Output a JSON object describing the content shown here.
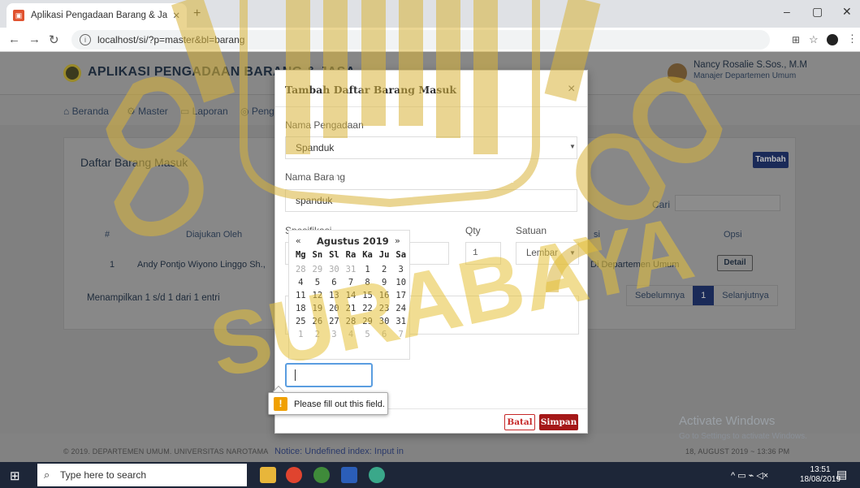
{
  "browser": {
    "tab_title": "Aplikasi Pengadaan Barang & Ja",
    "new_tab": "+",
    "url": "localhost/si/?p=master&bl=barang",
    "window_controls": [
      "–",
      "▢",
      "✕"
    ]
  },
  "app": {
    "title": "APLIKASI PENGADAAN BARANG & JASA",
    "user_name": "Nancy Rosalie S.Sos., M.M",
    "user_role": "Manajer Departemen Umum",
    "menu": [
      "Beranda",
      "Master",
      "Laporan",
      "Peng"
    ],
    "card_title": "Daftar Barang Masuk",
    "add_button": "Tambah",
    "search_label": "Cari",
    "table": {
      "headers": [
        "#",
        "Diajukan Oleh",
        "si",
        "Opsi"
      ],
      "rows": [
        {
          "no": "1",
          "by": "Andy Pontjo Wiyono Linggo Sh.,",
          "dept": "Di Departemen Umum",
          "action": "Detail"
        }
      ]
    },
    "info": "Menampilkan 1 s/d 1 dari 1 entri",
    "pager": [
      "Sebelumnya",
      "1",
      "Selanjutnya"
    ],
    "footer_copy": "© 2019. DEPARTEMEN UMUM. UNIVERSITAS NAROTAMA",
    "notice": "Notice: Undefined index: Input in",
    "footer_date": "18, AUGUST 2019 ~ 13:36 PM"
  },
  "modal": {
    "title": "Tambah Daftar Barang Masuk",
    "close": "×",
    "label_pengadaan": "Nama Pengadaan",
    "pengadaan_value": "Spanduk",
    "label_barang": "Nama Barang",
    "barang_value": "spanduk",
    "label_spesifikasi": "Spesifikasi",
    "label_qty": "Qty",
    "qty_value": "1",
    "label_satuan": "Satuan",
    "satuan_value": "Lembar",
    "cancel": "Batal",
    "save": "Simpan"
  },
  "datepicker": {
    "prev": "«",
    "month": "Agustus 2019",
    "next": "»",
    "days": [
      "Mg",
      "Sn",
      "Sl",
      "Ra",
      "Ka",
      "Ju",
      "Sa"
    ],
    "dates": [
      [
        "28",
        "29",
        "30",
        "31",
        "1",
        "2",
        "3"
      ],
      [
        "4",
        "5",
        "6",
        "7",
        "8",
        "9",
        "10"
      ],
      [
        "11",
        "12",
        "13",
        "14",
        "15",
        "16",
        "17"
      ],
      [
        "18",
        "19",
        "20",
        "21",
        "22",
        "23",
        "24"
      ],
      [
        "25",
        "26",
        "27",
        "28",
        "29",
        "30",
        "31"
      ],
      [
        "1",
        "2",
        "3",
        "4",
        "5",
        "6",
        "7"
      ]
    ]
  },
  "validation": {
    "icon": "!",
    "message": "Please fill out this field."
  },
  "watermark": {
    "text_top": "PRO PATRIA",
    "text_bottom": "SURABAYA"
  },
  "windows": {
    "activate_title": "Activate Windows",
    "activate_sub": "Go to Settings to activate Windows.",
    "search_placeholder": "Type here to search",
    "time": "13:51",
    "date": "18/08/2019"
  }
}
